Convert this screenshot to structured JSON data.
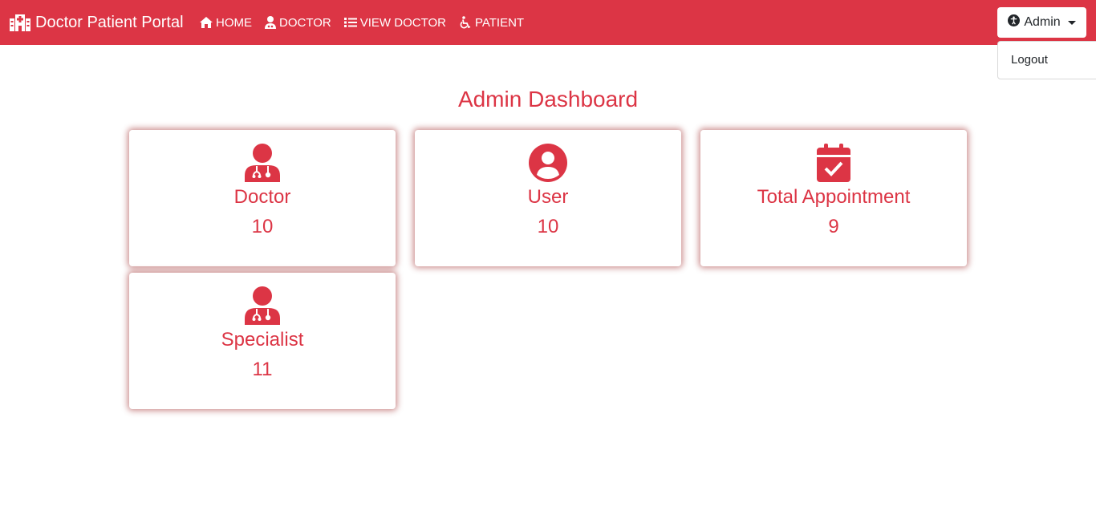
{
  "navbar": {
    "brand": "Doctor Patient Portal",
    "links": [
      {
        "label": "HOME",
        "icon": "home-icon"
      },
      {
        "label": "DOCTOR",
        "icon": "doctor-icon"
      },
      {
        "label": "VIEW DOCTOR",
        "icon": "list-icon"
      },
      {
        "label": "PATIENT",
        "icon": "wheelchair-icon"
      }
    ],
    "user_menu": {
      "label": "Admin",
      "icon": "accessibility-icon"
    },
    "dropdown": {
      "items": [
        "Logout"
      ]
    }
  },
  "main": {
    "title": "Admin Dashboard",
    "cards": [
      {
        "label": "Doctor",
        "value": "10",
        "icon": "doctor-icon"
      },
      {
        "label": "User",
        "value": "10",
        "icon": "user-circle-icon"
      },
      {
        "label": "Total Appointment",
        "value": "9",
        "icon": "calendar-check-icon"
      },
      {
        "label": "Specialist",
        "value": "11",
        "icon": "doctor-icon"
      }
    ]
  },
  "colors": {
    "primary": "#dc3545",
    "text_dark": "#212529",
    "background": "#ffffff"
  }
}
